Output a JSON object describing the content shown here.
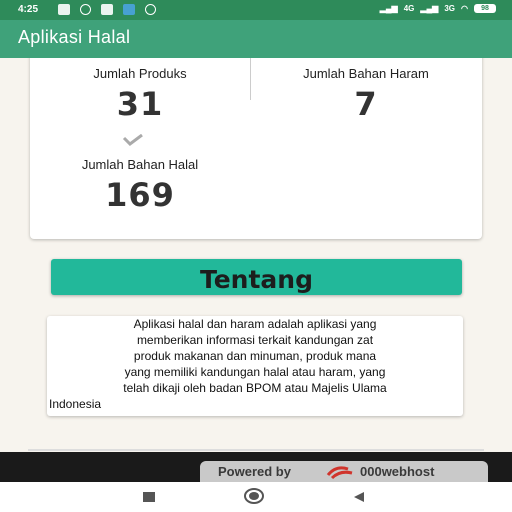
{
  "status_bar": {
    "time": "4:25",
    "network_4g": "4G",
    "network_3g": "3G",
    "battery": "98"
  },
  "app_bar": {
    "title": "Aplikasi Halal"
  },
  "stats": {
    "produk": {
      "label": "Jumlah Produks",
      "value": "31"
    },
    "haram": {
      "label": "Jumlah Bahan Haram",
      "value": "7"
    },
    "halal": {
      "label": "Jumlah Bahan Halal",
      "value": "169"
    }
  },
  "about_button": {
    "label": "Tentang"
  },
  "description": {
    "lines": [
      "Aplikasi halal dan haram adalah aplikasi yang",
      "memberikan informasi terkait kandungan zat",
      "produk makanan dan minuman, produk mana",
      "yang memiliki kandungan halal atau haram, yang",
      "telah dikaji oleh badan BPOM atau Majelis Ulama",
      "Indonesia"
    ]
  },
  "footer": {
    "powered_by": "Powered by",
    "brand": "000webhost"
  },
  "colors": {
    "status_bar": "#2e8b5a",
    "app_bar": "#3fa27a",
    "button": "#22b89a"
  }
}
